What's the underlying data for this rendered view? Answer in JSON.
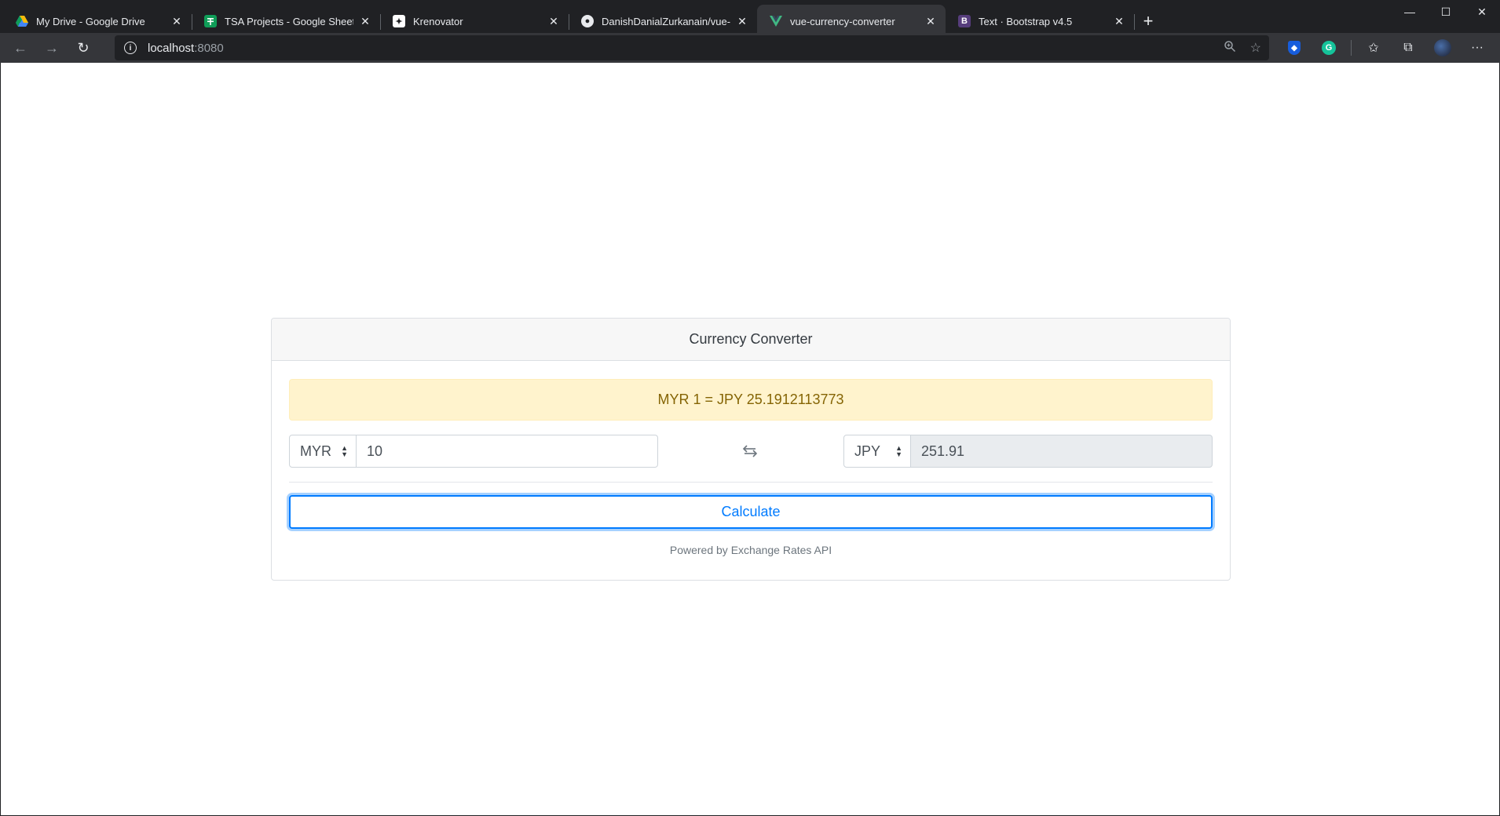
{
  "browser": {
    "tabs": [
      {
        "title": "My Drive - Google Drive",
        "icon": "google-drive-icon"
      },
      {
        "title": "TSA Projects - Google Sheets",
        "icon": "google-sheets-icon"
      },
      {
        "title": "Krenovator",
        "icon": "krenovator-icon"
      },
      {
        "title": "DanishDanialZurkanain/vue-currency-converter",
        "icon": "github-icon"
      },
      {
        "title": "vue-currency-converter",
        "icon": "vue-icon",
        "active": true
      },
      {
        "title": "Text · Bootstrap v4.5",
        "icon": "bootstrap-icon",
        "fav_letter": "B"
      }
    ],
    "url_host": "localhost",
    "url_port": ":8080"
  },
  "converter": {
    "title": "Currency Converter",
    "rate_text": "MYR 1 = JPY 25.1912113773",
    "from_currency": "MYR",
    "from_amount": "10",
    "to_currency": "JPY",
    "to_amount": "251.91",
    "calculate_label": "Calculate",
    "footer": "Powered by Exchange Rates API"
  },
  "colors": {
    "primary": "#007bff",
    "alert_bg": "#fff3cd",
    "alert_text": "#856404",
    "readonly_bg": "#e9ecef"
  }
}
